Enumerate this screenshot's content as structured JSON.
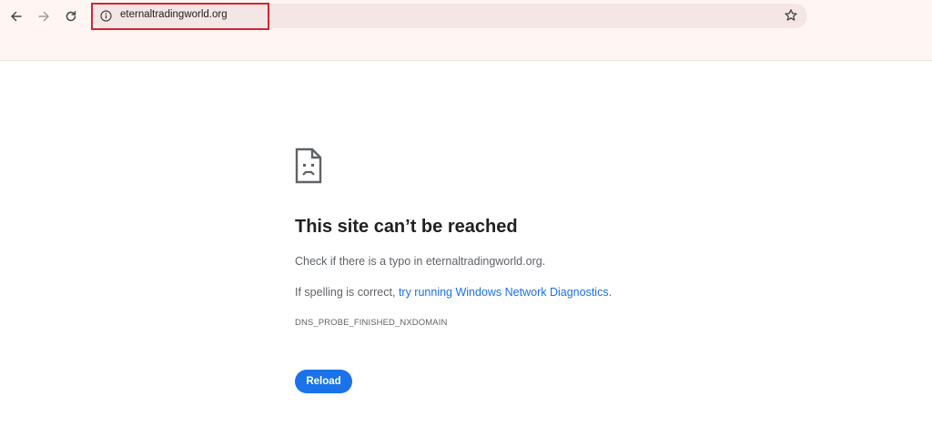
{
  "browser": {
    "url": "eternaltradingworld.org",
    "icons": {
      "back": "arrow-left-icon",
      "forward": "arrow-right-icon",
      "reload": "reload-icon",
      "site_info": "info-icon",
      "bookmark": "star-icon"
    },
    "highlight_color": "#d6232f"
  },
  "error_page": {
    "icon": "sad-page-icon",
    "title": "This site can’t be reached",
    "check_prefix": "Check if there is a typo in ",
    "check_domain": "eternaltradingworld.org",
    "check_suffix": ".",
    "spelling_prefix": "If spelling is correct, ",
    "spelling_link": "try running Windows Network Diagnostics",
    "spelling_suffix": ".",
    "error_code": "DNS_PROBE_FINISHED_NXDOMAIN",
    "reload_label": "Reload"
  },
  "colors": {
    "toolbar_bg": "#fff5f2",
    "omnibox_bg": "#f3e6e4",
    "link": "#1a73e8",
    "button": "#1a73e8"
  }
}
